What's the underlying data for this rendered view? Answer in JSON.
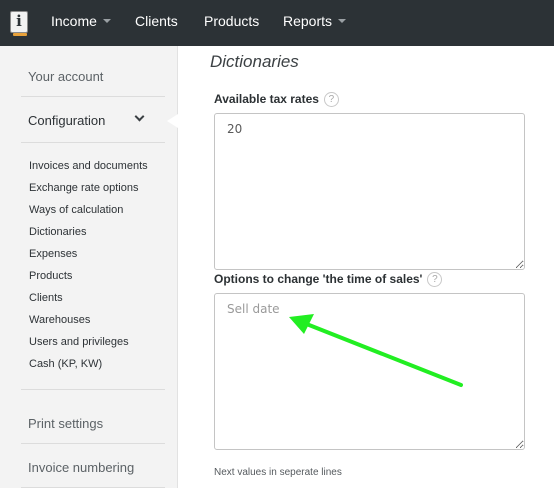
{
  "navbar": {
    "logo": "i",
    "items": [
      {
        "label": "Income",
        "dropdown": true
      },
      {
        "label": "Clients",
        "dropdown": false
      },
      {
        "label": "Products",
        "dropdown": false
      },
      {
        "label": "Reports",
        "dropdown": true
      }
    ]
  },
  "sidebar": {
    "your_account": "Your account",
    "configuration": "Configuration",
    "links": [
      "Invoices and documents",
      "Exchange rate options",
      "Ways of calculation",
      "Dictionaries",
      "Expenses",
      "Products",
      "Clients",
      "Warehouses",
      "Users and privileges",
      "Cash (KP, KW)"
    ],
    "print_settings": "Print settings",
    "invoice_numbering": "Invoice numbering"
  },
  "main": {
    "title": "Dictionaries",
    "tax_rates": {
      "label": "Available tax rates",
      "help": "?",
      "value": "20"
    },
    "time_of_sales": {
      "label": "Options to change 'the time of sales'",
      "help": "?",
      "placeholder": "Sell date"
    },
    "hint": "Next values in seperate lines"
  },
  "annotation": {
    "arrow_color": "#22ee22"
  }
}
